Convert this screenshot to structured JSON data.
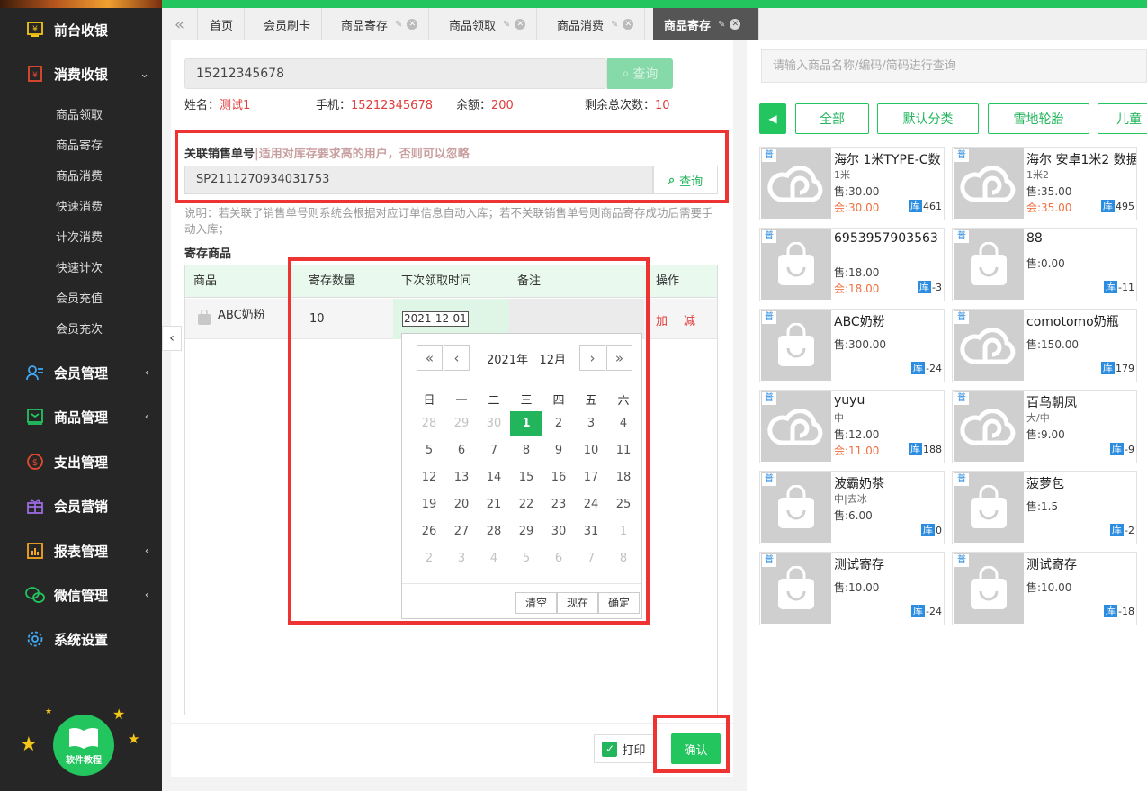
{
  "sidebar": {
    "items": [
      {
        "label": "前台收银",
        "icon": "cashier-icon",
        "chevron": ""
      },
      {
        "label": "消费收银",
        "icon": "consume-cashier-icon",
        "chevron": "⌄"
      },
      {
        "label": "会员管理",
        "icon": "member-icon",
        "chevron": "‹"
      },
      {
        "label": "商品管理",
        "icon": "goods-icon",
        "chevron": "‹"
      },
      {
        "label": "支出管理",
        "icon": "expense-icon",
        "chevron": ""
      },
      {
        "label": "会员营销",
        "icon": "gift-icon",
        "chevron": ""
      },
      {
        "label": "报表管理",
        "icon": "report-icon",
        "chevron": "‹"
      },
      {
        "label": "微信管理",
        "icon": "wechat-icon",
        "chevron": "‹"
      },
      {
        "label": "系统设置",
        "icon": "settings-icon",
        "chevron": ""
      }
    ],
    "subitems": [
      "商品领取",
      "商品寄存",
      "商品消费",
      "快速消费",
      "计次消费",
      "快速计次",
      "会员充值",
      "会员充次"
    ],
    "help_label": "软件教程"
  },
  "tabs": [
    {
      "label": "首页"
    },
    {
      "label": "会员刷卡"
    },
    {
      "label": "商品寄存"
    },
    {
      "label": "商品领取"
    },
    {
      "label": "商品消费"
    },
    {
      "label": "商品寄存"
    }
  ],
  "member": {
    "phone_value": "15212345678",
    "search_label": "查询",
    "name_label": "姓名：",
    "name_value": "测试1",
    "mobile_label": "手机：",
    "mobile_value": "15212345678",
    "balance_label": "余额：",
    "balance_value": "200",
    "times_label": "剩余总次数：",
    "times_value": "10"
  },
  "related": {
    "label": "关联销售单号",
    "hint": "|适用对库存要求高的用户，否则可以忽略",
    "value": "SP2111270934031753",
    "search_label": "查询",
    "note": "说明：若关联了销售单号则系统会根据对应订单信息自动入库；若不关联销售单号则商品寄存成功后需要手动入库；"
  },
  "deposit": {
    "section_title": "寄存商品",
    "headers": {
      "product": "商品",
      "qty": "寄存数量",
      "next_time": "下次领取时间",
      "remark": "备注",
      "action": "操作"
    },
    "row": {
      "product": "ABC奶粉",
      "qty": "10",
      "date": "2021-12-01",
      "add": "加",
      "minus": "减"
    }
  },
  "calendar": {
    "year_label": "2021年",
    "month_label": "12月",
    "weekdays": [
      "日",
      "一",
      "二",
      "三",
      "四",
      "五",
      "六"
    ],
    "days": [
      [
        "28",
        "29",
        "30",
        "1",
        "2",
        "3",
        "4"
      ],
      [
        "5",
        "6",
        "7",
        "8",
        "9",
        "10",
        "11"
      ],
      [
        "12",
        "13",
        "14",
        "15",
        "16",
        "17",
        "18"
      ],
      [
        "19",
        "20",
        "21",
        "22",
        "23",
        "24",
        "25"
      ],
      [
        "26",
        "27",
        "28",
        "29",
        "30",
        "31",
        "1"
      ],
      [
        "2",
        "3",
        "4",
        "5",
        "6",
        "7",
        "8"
      ]
    ],
    "clear_label": "清空",
    "now_label": "现在",
    "ok_label": "确定"
  },
  "footer": {
    "print_label": "打印",
    "confirm_label": "确认"
  },
  "right": {
    "search_placeholder": "请输入商品名称/编码/简码进行查询",
    "categories": [
      "全部",
      "默认分类",
      "雪地轮胎",
      "儿童"
    ],
    "products": [
      {
        "name": "海尔 1米TYPE-C数",
        "spec": "1米",
        "sale": "售:30.00",
        "member": "会:30.00",
        "stock": "461",
        "img": "cloud"
      },
      {
        "name": "海尔 安卓1米2 数据",
        "spec": "1米2",
        "sale": "售:35.00",
        "member": "会:35.00",
        "stock": "495",
        "img": "cloud"
      },
      {
        "name": "6953957903563",
        "spec": "",
        "sale": "售:18.00",
        "member": "会:18.00",
        "stock": "-3",
        "img": "bag"
      },
      {
        "name": "88",
        "spec": "",
        "sale": "售:0.00",
        "member": "",
        "stock": "-11",
        "img": "bag"
      },
      {
        "name": "ABC奶粉",
        "spec": "",
        "sale": "售:300.00",
        "member": "",
        "stock": "-24",
        "img": "bag"
      },
      {
        "name": "comotomo奶瓶",
        "spec": "",
        "sale": "售:150.00",
        "member": "",
        "stock": "179",
        "img": "cloud"
      },
      {
        "name": "yuyu",
        "spec": "中",
        "sale": "售:12.00",
        "member": "会:11.00",
        "stock": "188",
        "img": "cloud"
      },
      {
        "name": "百鸟朝凤",
        "spec": "大/中",
        "sale": "售:9.00",
        "member": "",
        "stock": "-9",
        "img": "cloud"
      },
      {
        "name": "波霸奶茶",
        "spec": "中|去冰",
        "sale": "售:6.00",
        "member": "",
        "stock": "0",
        "img": "bag"
      },
      {
        "name": "菠萝包",
        "spec": "",
        "sale": "售:1.5",
        "member": "",
        "stock": "-2",
        "img": "bag"
      },
      {
        "name": "测试寄存",
        "spec": "",
        "sale": "售:10.00",
        "member": "",
        "stock": "-24",
        "img": "bag"
      },
      {
        "name": "测试寄存",
        "spec": "",
        "sale": "售:10.00",
        "member": "",
        "stock": "-18",
        "img": "bag"
      }
    ],
    "tag_label": "普",
    "stock_label": "库"
  },
  "colors": {
    "accent": "#22c55e",
    "highlight": "#ee3333",
    "value_red": "#e23b3b",
    "sidebar_bg": "#262626"
  }
}
